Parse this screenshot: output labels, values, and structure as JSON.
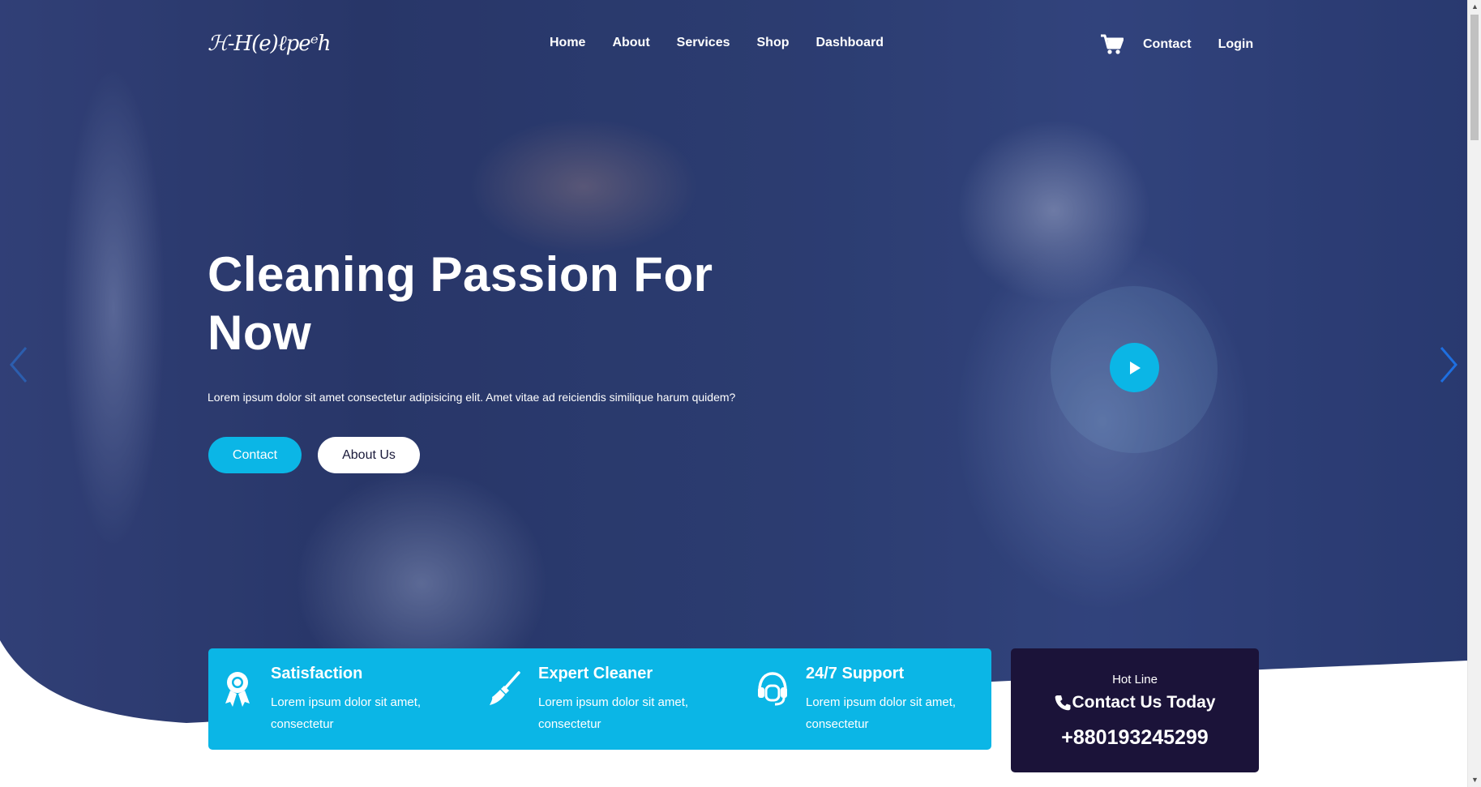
{
  "navbar": {
    "logo_text": "ℋ-H(e)ℓpeᵉh",
    "links": [
      {
        "label": "Home"
      },
      {
        "label": "About"
      },
      {
        "label": "Services"
      },
      {
        "label": "Shop"
      },
      {
        "label": "Dashboard"
      }
    ],
    "right_links": [
      {
        "label": "Contact"
      },
      {
        "label": "Login"
      }
    ],
    "cart_icon": "cart-icon"
  },
  "hero": {
    "title": "Cleaning Passion For Now",
    "description": "Lorem ipsum dolor sit amet consectetur adipisicing elit. Amet vitae ad reiciendis similique harum quidem?",
    "buttons": {
      "contact": "Contact",
      "about": "About Us"
    },
    "play_icon": "play-icon",
    "prev_icon": "chevron-left-icon",
    "next_icon": "chevron-right-icon"
  },
  "features": [
    {
      "icon": "award-icon",
      "title": "Satisfaction",
      "text": "Lorem ipsum dolor sit amet, consectetur"
    },
    {
      "icon": "broom-icon",
      "title": "Expert Cleaner",
      "text": "Lorem ipsum dolor sit amet, consectetur"
    },
    {
      "icon": "headset-icon",
      "title": "24/7 Support",
      "text": "Lorem ipsum dolor sit amet, consectetur"
    }
  ],
  "hotline": {
    "label": "Hot Line",
    "title": "Contact Us Today",
    "phone": "+880193245299",
    "icon": "phone-icon"
  },
  "colors": {
    "accent": "#0bb6e6",
    "dark": "#1b1339",
    "white": "#ffffff"
  }
}
